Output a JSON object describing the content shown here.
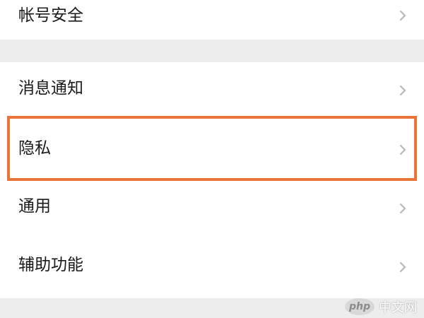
{
  "settings": {
    "top_group": {
      "account_security": "帐号安全"
    },
    "main_group": {
      "notifications": "消息通知",
      "privacy": "隐私",
      "general": "通用",
      "accessibility": "辅助功能"
    }
  },
  "icons": {
    "chevron": "chevron-right-icon"
  },
  "colors": {
    "highlight": "#e8743b",
    "background": "#ededed",
    "panel": "#ffffff",
    "chevron": "#b8b8b8",
    "text": "#1a1a1a"
  },
  "watermark": {
    "logo_text": "php",
    "site_text": "中文网"
  }
}
